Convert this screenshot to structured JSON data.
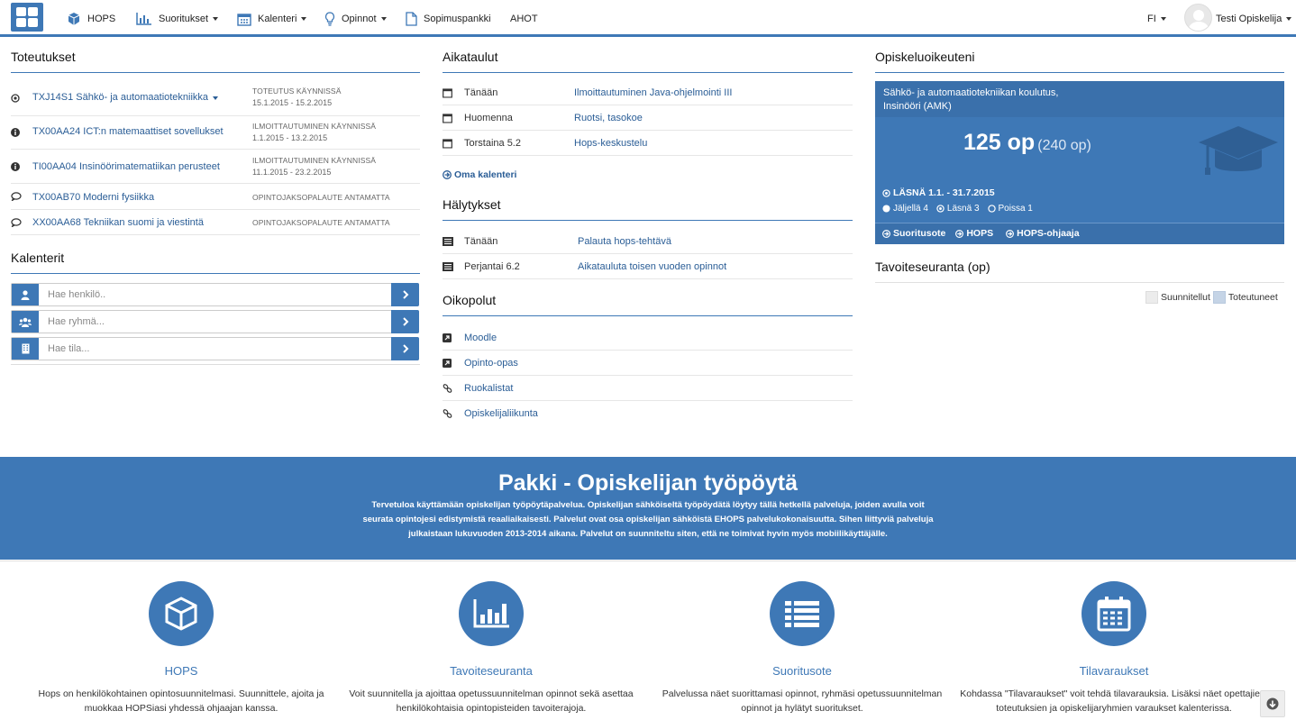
{
  "nav": {
    "hops": "HOPS",
    "suoritukset": "Suoritukset",
    "kalenteri": "Kalenteri",
    "opinnot": "Opinnot",
    "sopimuspankki": "Sopimuspankki",
    "ahot": "AHOT",
    "lang": "FI",
    "user": "Testi Opiskelija"
  },
  "toteutukset": {
    "title": "Toteutukset",
    "rows": [
      {
        "name": "TXJ14S1 Sähkö- ja automaatiotekniikka",
        "status": "TOTEUTUS KÄYNNISSÄ",
        "dates": "15.1.2015 - 15.2.2015"
      },
      {
        "name": "TX00AA24 ICT:n matemaattiset sovellukset",
        "status": "ILMOITTAUTUMINEN KÄYNNISSÄ",
        "dates": "1.1.2015 - 13.2.2015"
      },
      {
        "name": "TI00AA04 Insinöörimatematiikan perusteet",
        "status": "ILMOITTAUTUMINEN KÄYNNISSÄ",
        "dates": "11.1.2015 - 23.2.2015"
      },
      {
        "name": "TX00AB70 Moderni fysiikka",
        "status": "OPINTOJAKSOPALAUTE ANTAMATTA",
        "dates": ""
      },
      {
        "name": "XX00AA68 Tekniikan suomi ja viestintä",
        "status": "OPINTOJAKSOPALAUTE ANTAMATTA",
        "dates": ""
      }
    ]
  },
  "kalenterit": {
    "title": "Kalenterit",
    "person_placeholder": "Hae henkilö..",
    "group_placeholder": "Hae ryhmä...",
    "room_placeholder": "Hae tila..."
  },
  "aikataulut": {
    "title": "Aikataulut",
    "rows": [
      {
        "day": "Tänään",
        "event": "Ilmoittautuminen Java-ohjelmointi III"
      },
      {
        "day": "Huomenna",
        "event": "Ruotsi, tasokoe"
      },
      {
        "day": "Torstaina 5.2",
        "event": "Hops-keskustelu"
      }
    ],
    "own_calendar": "Oma kalenteri"
  },
  "halytykset": {
    "title": "Hälytykset",
    "rows": [
      {
        "day": "Tänään",
        "event": "Palauta hops-tehtävä"
      },
      {
        "day": "Perjantai 6.2",
        "event": "Aikatauluta toisen vuoden opinnot"
      }
    ]
  },
  "oikopolut": {
    "title": "Oikopolut",
    "rows": [
      {
        "label": "Moodle",
        "icon": "external-link-icon"
      },
      {
        "label": "Opinto-opas",
        "icon": "external-link-icon"
      },
      {
        "label": "Ruokalistat",
        "icon": "link-icon"
      },
      {
        "label": "Opiskelijaliikunta",
        "icon": "link-icon"
      }
    ]
  },
  "opiskeluoikeus": {
    "title": "Opiskeluoikeuteni",
    "degree_line1": "Sähkö- ja automaatiotekniikan koulutus,",
    "degree_line2": "Insinööri (AMK)",
    "credits": "125 op",
    "credits_total": "(240 op)",
    "presence": "LÄSNÄ 1.1. - 31.7.2015",
    "remaining": "Jäljellä 4",
    "present": "Läsnä 3",
    "absent": "Poissa 1",
    "links": [
      "Suoritusote",
      "HOPS",
      "HOPS-ohjaaja"
    ]
  },
  "tavoiteseuranta": {
    "title": "Tavoiteseuranta (op)",
    "legend_planned": "Suunnitellut",
    "legend_done": "Toteutuneet"
  },
  "banner": {
    "title": "Pakki - Opiskelijan työpöytä",
    "text": "Tervetuloa käyttämään opiskelijan työpöytäpalvelua. Opiskelijan sähköiseltä työpöydätä löytyy tällä hetkellä palveluja, joiden avulla voit seurata opintojesi edistymistä reaaliaikaisesti. Palvelut ovat osa opiskelijan sähköistä EHOPS palvelukokonaisuutta. Sihen liittyviä palveluja julkaistaan lukuvuoden 2013-2014 aikana. Palvelut on suunniteltu siten, että ne toimivat hyvin myös mobiilikäyttäjälle."
  },
  "features": [
    {
      "title": "HOPS",
      "desc": "Hops on henkilökohtainen opintosuunnitelmasi. Suunnittele, ajoita ja muokkaa HOPSiasi yhdessä ohjaajan kanssa.",
      "icon": "cube-icon"
    },
    {
      "title": "Tavoiteseuranta",
      "desc": "Voit suunnitella ja ajoittaa opetussuunnitelman opinnot sekä asettaa henkilökohtaisia opintopisteiden tavoiterajoja.",
      "icon": "bar-chart-icon"
    },
    {
      "title": "Suoritusote",
      "desc": "Palvelussa näet suorittamasi opinnot, ryhmäsi opetussuunnitelman opinnot ja hylätyt suoritukset.",
      "icon": "list-icon"
    },
    {
      "title": "Tilavaraukset",
      "desc": "Kohdassa \"Tilavaraukset\" voit tehdä tilavarauksia. Lisäksi näet opettajien, toteutuksien ja opiskelijaryhmien varaukset kalenterissa.",
      "icon": "calendar-icon"
    }
  ],
  "colors": {
    "brand": "#3e78b6",
    "link": "#2a5d96"
  }
}
